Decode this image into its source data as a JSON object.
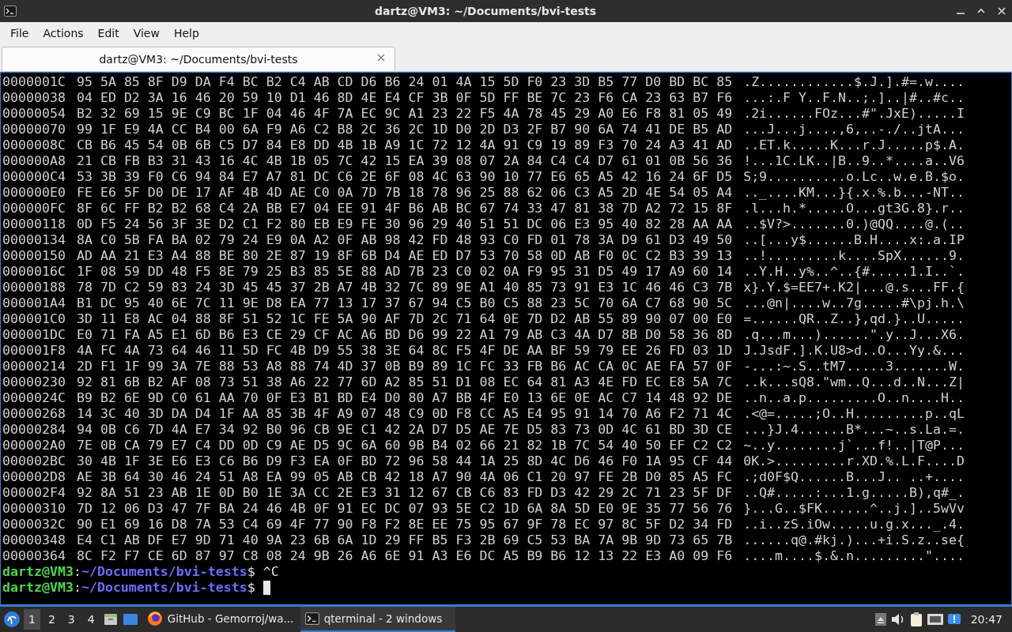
{
  "window": {
    "title": "dartz@VM3: ~/Documents/bvi-tests"
  },
  "menu": [
    "File",
    "Actions",
    "Edit",
    "View",
    "Help"
  ],
  "tabs": [
    {
      "label": "dartz@VM3: ~/Documents/bvi-tests",
      "selected": true
    }
  ],
  "dump": [
    {
      "address": "0000001C",
      "hex": "95 5A 85 8F D9 DA F4 BC B2 C4 AB CD D6 B6 24 01 4A 15 5D F0 23 3D B5 77 D0 BD BC 85",
      "ascii": ".Z............$.J.].#=.w...."
    },
    {
      "address": "00000038",
      "hex": "04 ED D2 3A 16 46 20 59 10 D1 46 8D 4E E4 CF 3B 0F 5D FF BE 7C 23 F6 CA 23 63 B7 F6",
      "ascii": "...:.F Y..F.N..;.]..|#..#c.."
    },
    {
      "address": "00000054",
      "hex": "B2 32 69 15 9E C9 BC 1F 04 46 4F 7A EC 9C A1 23 22 F5 4A 78 45 29 A0 E6 F8 81 05 49",
      "ascii": ".2i......FOz...#\".JxE).....I"
    },
    {
      "address": "00000070",
      "hex": "99 1F E9 4A CC B4 00 6A F9 A6 C2 B8 2C 36 2C 1D D0 2D D3 2F B7 90 6A 74 41 DE B5 AD",
      "ascii": "...J...j....,6,..-./..jtA..."
    },
    {
      "address": "0000008C",
      "hex": "CB B6 45 54 0B 6B C5 D7 84 E8 DD 4B 1B A9 1C 72 12 4A 91 C9 19 89 F3 70 24 A3 41 AD",
      "ascii": "..ET.k.....K...r.J.....p$.A."
    },
    {
      "address": "000000A8",
      "hex": "21 CB FB B3 31 43 16 4C 4B 1B 05 7C 42 15 EA 39 08 07 2A 84 C4 C4 D7 61 01 0B 56 36",
      "ascii": "!...1C.LK..|B..9..*....a..V6"
    },
    {
      "address": "000000C4",
      "hex": "53 3B 39 F0 C6 94 84 E7 A7 81 DC C6 2E 6F 08 4C 63 90 10 77 E6 65 A5 42 16 24 6F D5",
      "ascii": "S;9..........o.Lc..w.e.B.$o."
    },
    {
      "address": "000000E0",
      "hex": "FE E6 5F D0 DE 17 AF 4B 4D AE C0 0A 7D 7B 18 78 96 25 88 62 06 C3 A5 2D 4E 54 05 A4",
      "ascii": ".._....KM...}{.x.%.b...-NT.."
    },
    {
      "address": "000000FC",
      "hex": "8F 6C FF B2 B2 68 C4 2A BB E7 04 EE 91 4F B6 AB BC 67 74 33 47 81 38 7D A2 72 15 8F",
      "ascii": ".l...h.*.....O...gt3G.8}.r.."
    },
    {
      "address": "00000118",
      "hex": "0D F5 24 56 3F 3E D2 C1 F2 80 EB E9 FE 30 96 29 40 51 51 DC 06 E3 95 40 82 28 AA AA",
      "ascii": "..$V?>.......0.)@QQ....@.(.."
    },
    {
      "address": "00000134",
      "hex": "8A C0 5B FA BA 02 79 24 E9 0A A2 0F AB 98 42 FD 48 93 C0 FD 01 78 3A D9 61 D3 49 50",
      "ascii": "..[...y$......B.H....x:.a.IP"
    },
    {
      "address": "00000150",
      "hex": "AD AA 21 E3 A4 88 BE 80 2E 87 19 8F 6B D4 AE ED D7 53 70 58 0D AB F0 0C C2 B3 39 13",
      "ascii": "..!.........k....SpX......9."
    },
    {
      "address": "0000016C",
      "hex": "1F 08 59 DD 48 F5 8E 79 25 B3 85 5E 88 AD 7B 23 C0 02 0A F9 95 31 D5 49 17 A9 60 14",
      "ascii": "..Y.H..y%..^..{#.....1.I..`."
    },
    {
      "address": "00000188",
      "hex": "78 7D C2 59 83 24 3D 45 45 37 2B A7 4B 32 7C 89 9E A1 40 85 73 91 E3 1C 46 46 C3 7B",
      "ascii": "x}.Y.$=EE7+.K2|...@.s...FF.{"
    },
    {
      "address": "000001A4",
      "hex": "B1 DC 95 40 6E 7C 11 9E D8 EA 77 13 17 37 67 94 C5 B0 C5 88 23 5C 70 6A C7 68 90 5C",
      "ascii": "...@n|....w..7g.....#\\pj.h.\\"
    },
    {
      "address": "000001C0",
      "hex": "3D 11 E8 AC 04 88 8F 51 52 1C FE 5A 90 AF 7D 2C 71 64 0E 7D D2 AB 55 89 90 07 00 E0",
      "ascii": "=......QR..Z..},qd.}..U....."
    },
    {
      "address": "000001DC",
      "hex": "E0 71 FA A5 E1 6D B6 E3 CE 29 CF AC A6 BD D6 99 22 A1 79 AB C3 4A D7 8B D0 58 36 8D",
      "ascii": ".q...m...)......\".y..J...X6."
    },
    {
      "address": "000001F8",
      "hex": "4A FC 4A 73 64 46 11 5D FC 4B D9 55 38 3E 64 8C F5 4F DE AA BF 59 79 EE 26 FD 03 1D",
      "ascii": "J.JsdF.].K.U8>d..O...Yy.&..."
    },
    {
      "address": "00000214",
      "hex": "2D F1 1F 99 3A 7E 88 53 A8 88 74 4D 37 0B B9 89 1C FC 33 FB B6 AC CA 0C AE FA 57 0F",
      "ascii": "-...:~.S..tM7.....3.......W."
    },
    {
      "address": "00000230",
      "hex": "92 81 6B B2 AF 08 73 51 38 A6 22 77 6D A2 85 51 D1 08 EC 64 81 A3 4E FD EC E8 5A 7C",
      "ascii": "..k...sQ8.\"wm..Q...d..N...Z|"
    },
    {
      "address": "0000024C",
      "hex": "B9 B2 6E 9D C0 61 AA 70 0F E3 B1 BD E4 D0 80 A7 BB 4F E0 13 6E 0E AC C7 14 48 92 DE",
      "ascii": "..n..a.p.........O..n....H.."
    },
    {
      "address": "00000268",
      "hex": "14 3C 40 3D DA D4 1F AA 85 3B 4F A9 07 48 C9 0D F8 CC A5 E4 95 91 14 70 A6 F2 71 4C",
      "ascii": ".<@=.....;O..H.........p..qL"
    },
    {
      "address": "00000284",
      "hex": "94 0B C6 7D 4A E7 34 92 B0 96 CB 9E C1 42 2A D7 D5 AE 7E D5 83 73 0D 4C 61 BD 3D CE",
      "ascii": "...}J.4......B*...~..s.La.=."
    },
    {
      "address": "000002A0",
      "hex": "7E 0B CA 79 E7 C4 DD 0D C9 AE D5 9C 6A 60 9B B4 02 66 21 82 1B 7C 54 40 50 EF C2 C2",
      "ascii": "~..y........j`...f!..|T@P..."
    },
    {
      "address": "000002BC",
      "hex": "30 4B 1F 3E E6 E3 C6 B6 D9 F3 EA 0F BD 72 96 58 44 1A 25 8D 4C D6 46 F0 1A 95 CF 44",
      "ascii": "0K.>.........r.XD.%.L.F....D"
    },
    {
      "address": "000002D8",
      "hex": "AE 3B 64 30 46 24 51 A8 EA 99 05 AB CB 42 18 A7 90 4A 06 C1 20 97 FE 2B D0 85 A5 FC",
      "ascii": ".;d0F$Q......B...J.. ..+...."
    },
    {
      "address": "000002F4",
      "hex": "92 8A 51 23 AB 1E 0D B0 1E 3A CC 2E E3 31 12 67 CB C6 83 FD D3 42 29 2C 71 23 5F DF",
      "ascii": "..Q#.....:...1.g.....B),q#_."
    },
    {
      "address": "00000310",
      "hex": "7D 12 06 D3 47 7F BA 24 46 4B 0F 91 EC DC 07 93 5E C2 1D 6A 8A 5D E0 9E 35 77 56 76",
      "ascii": "}...G..$FK......^..j.]..5wVv"
    },
    {
      "address": "0000032C",
      "hex": "90 E1 69 16 D8 7A 53 C4 69 4F 77 90 F8 F2 8E EE 75 95 67 9F 78 EC 97 8C 5F D2 34 FD",
      "ascii": "..i..zS.iOw.....u.g.x..._.4."
    },
    {
      "address": "00000348",
      "hex": "E4 C1 AB DF E7 9D 71 40 9A 23 6B 6A 1D 29 FF B5 F3 2B 69 C5 53 BA 7A 9B 9D 73 65 7B",
      "ascii": "......q@.#kj.)...+i.S.z..se{"
    },
    {
      "address": "00000364",
      "hex": "8C F2 F7 CE 6D 87 97 C8 08 24 9B 26 A6 6E 91 A3 E6 DC A5 B9 B6 12 13 22 E3 A0 09 F6",
      "ascii": "....m....$.&.n.........\"...."
    }
  ],
  "prompts": [
    {
      "user": "dartz@VM3",
      "separator": ":",
      "path": "~/Documents/bvi-tests",
      "symbol": "$",
      "command": "^C",
      "cursor": false
    },
    {
      "user": "dartz@VM3",
      "separator": ":",
      "path": "~/Documents/bvi-tests",
      "symbol": "$",
      "cursor": true
    }
  ],
  "taskbar": {
    "workspaces": [
      {
        "label": "1",
        "selected": true
      },
      {
        "label": "2",
        "selected": false
      },
      {
        "label": "3",
        "selected": false
      },
      {
        "label": "4",
        "selected": false
      }
    ],
    "tasks": [
      {
        "kind": "browser",
        "label": "GitHub - Gemorroj/wa...",
        "selected": false
      },
      {
        "kind": "terminal",
        "label": "qterminal - 2 windows",
        "selected": true
      }
    ],
    "clock": "20:47"
  }
}
